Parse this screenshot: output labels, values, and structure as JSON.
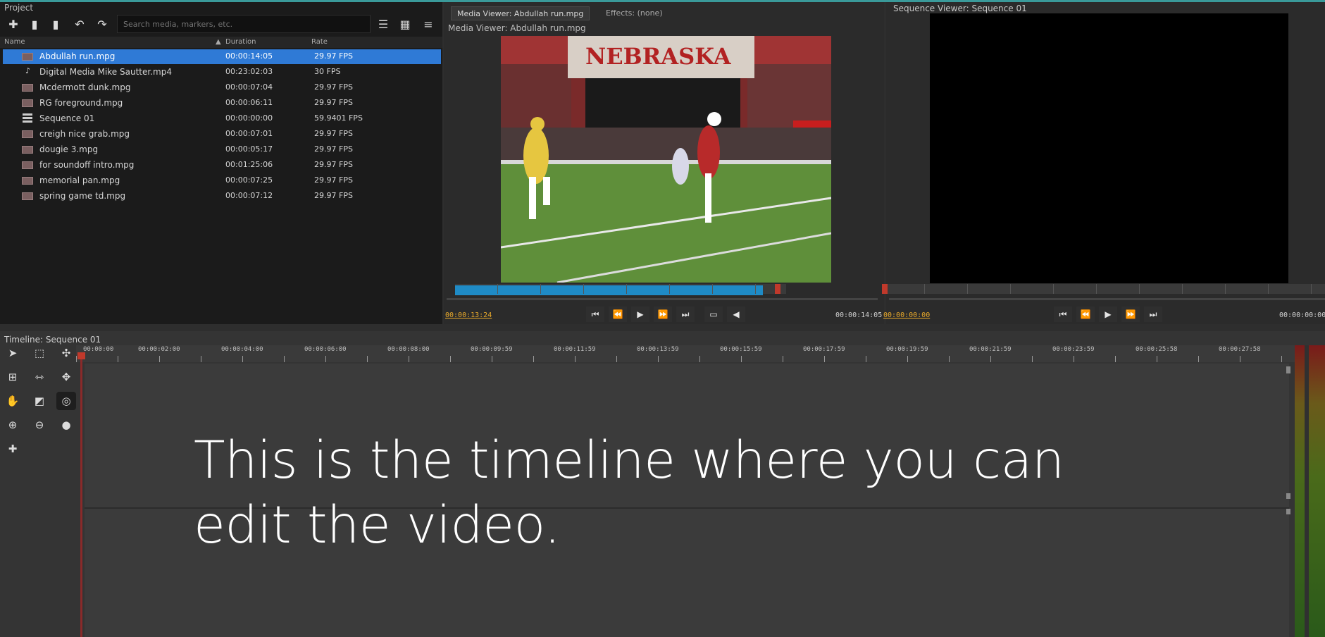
{
  "project": {
    "title": "Project",
    "search_placeholder": "Search media, markers, etc.",
    "columns": {
      "name": "Name",
      "duration": "Duration",
      "rate": "Rate"
    },
    "items": [
      {
        "name": "Abdullah run.mpg",
        "duration": "00:00:14:05",
        "rate": "29.97 FPS",
        "icon": "video-thumb-icon",
        "selected": true
      },
      {
        "name": "Digital Media Mike Sautter.mp4",
        "duration": "00:23:02:03",
        "rate": "30 FPS",
        "icon": "audio-icon",
        "selected": false
      },
      {
        "name": "Mcdermott dunk.mpg",
        "duration": "00:00:07:04",
        "rate": "29.97 FPS",
        "icon": "video-thumb-icon",
        "selected": false
      },
      {
        "name": "RG foreground.mpg",
        "duration": "00:00:06:11",
        "rate": "29.97 FPS",
        "icon": "video-thumb-icon",
        "selected": false
      },
      {
        "name": "Sequence 01",
        "duration": "00:00:00:00",
        "rate": "59.9401 FPS",
        "icon": "sequence-icon",
        "selected": false
      },
      {
        "name": "creigh nice grab.mpg",
        "duration": "00:00:07:01",
        "rate": "29.97 FPS",
        "icon": "video-thumb-icon",
        "selected": false
      },
      {
        "name": "dougie 3.mpg",
        "duration": "00:00:05:17",
        "rate": "29.97 FPS",
        "icon": "video-thumb-icon",
        "selected": false
      },
      {
        "name": "for soundoff intro.mpg",
        "duration": "00:01:25:06",
        "rate": "29.97 FPS",
        "icon": "video-thumb-icon",
        "selected": false
      },
      {
        "name": "memorial pan.mpg",
        "duration": "00:00:07:25",
        "rate": "29.97 FPS",
        "icon": "video-thumb-icon",
        "selected": false
      },
      {
        "name": "spring game td.mpg",
        "duration": "00:00:07:12",
        "rate": "29.97 FPS",
        "icon": "video-thumb-icon",
        "selected": false
      }
    ]
  },
  "media_viewer": {
    "tab1": "Media Viewer: Abdullah run.mpg",
    "tab2": "Effects: (none)",
    "title": "Media Viewer: Abdullah run.mpg",
    "banner": "NEBRASKA",
    "current_tc": "00:00:13:24",
    "end_tc": "00:00:14:05",
    "progress": 0.93
  },
  "sequence_viewer": {
    "title": "Sequence Viewer: Sequence 01",
    "current_tc": "00:00:00:00",
    "end_tc": "00:00:00:00"
  },
  "timeline": {
    "title": "Timeline: Sequence 01",
    "ruler": [
      "00:00:00",
      "00:00:02:00",
      "00:00:04:00",
      "00:00:06:00",
      "00:00:08:00",
      "00:00:09:59",
      "00:00:11:59",
      "00:00:13:59",
      "00:00:15:59",
      "00:00:17:59",
      "00:00:19:59",
      "00:00:21:59",
      "00:00:23:59",
      "00:00:25:58",
      "00:00:27:58"
    ]
  },
  "caption": "This is the timeline where you can edit the video.",
  "colors": {
    "selection": "#2f7ad6",
    "accent_orange": "#e7a82b",
    "progress": "#1f8bc6",
    "playhead": "#c0392b"
  }
}
